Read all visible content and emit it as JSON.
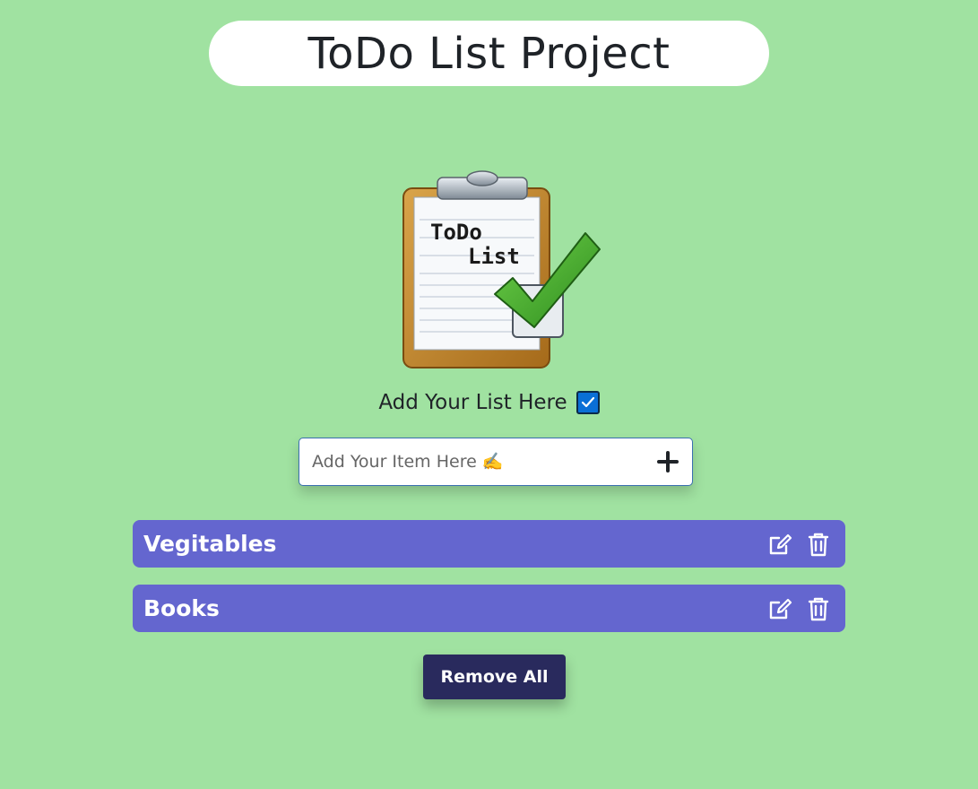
{
  "header": {
    "title": "ToDo List Project"
  },
  "logo": {
    "icon": "todo-clipboard-icon",
    "line1": "ToDo",
    "line2": "List"
  },
  "subtitle": {
    "text": "Add Your List Here",
    "icon": "checkbox-checked-icon"
  },
  "input": {
    "placeholder": "Add Your Item Here ✍️",
    "value": "",
    "add_icon": "plus-icon"
  },
  "items": [
    {
      "label": "Vegitables",
      "edit_icon": "edit-icon",
      "delete_icon": "trash-icon"
    },
    {
      "label": "Books",
      "edit_icon": "edit-icon",
      "delete_icon": "trash-icon"
    }
  ],
  "actions": {
    "remove_all_label": "Remove All"
  },
  "colors": {
    "background": "#a0e2a1",
    "item": "#6466cf",
    "button": "#292a5d",
    "accent": "#0a6fd6"
  }
}
